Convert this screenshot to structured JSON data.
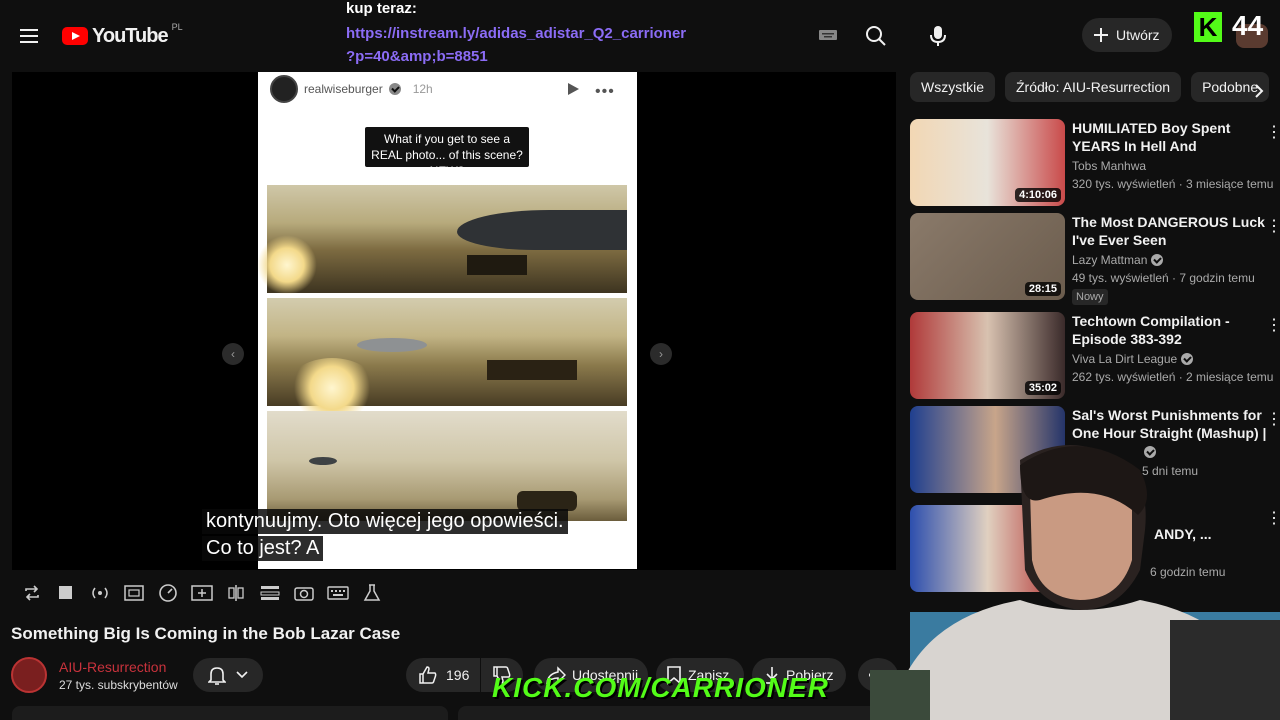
{
  "header": {
    "logo_text": "YouTube",
    "logo_country": "PL",
    "create_label": "Utwórz",
    "search_icon": "search-icon",
    "mic_icon": "mic-icon"
  },
  "stream_overlay": {
    "buy_label": "kup teraz:",
    "buy_link": "https://instream.ly/adidas_adistar_Q2_carrioner\n?p=40&amp;b=8851",
    "badge_letter": "K",
    "badge_count": "44",
    "kick_url": "KICK.COM/CARRIONER"
  },
  "player": {
    "post_user": "realwiseburger",
    "post_time": "12h",
    "post_question": "What if you get to see a REAL photo... of this scene? NEW?",
    "subtitle_line1": "kontynuujmy.  Oto więcej jego opowieści.",
    "subtitle_line2": "Co to jest?  A"
  },
  "video": {
    "title": "Something Big Is Coming in the Bob Lazar Case",
    "channel_name": "AIU-Resurrection",
    "channel_subs": "27 tys. subskrybentów",
    "likes": "196",
    "share_label": "Udostępnij",
    "save_label": "Zapisz",
    "download_label": "Pobierz"
  },
  "chips": [
    "Wszystkie",
    "Źródło: AIU-Resurrection",
    "Podobne"
  ],
  "recommendations": [
    {
      "title": "HUMILIATED Boy Spent YEARS In Hell And INSTANTLY Became...",
      "channel": "Tobs Manhwa",
      "verified": false,
      "meta": "320 tys. wyświetleń · 3 miesiące temu",
      "duration": "4:10:06",
      "badge": "",
      "thumb_color": "#c9b9a4"
    },
    {
      "title": "The Most DANGEROUS Luck I've Ever Seen",
      "channel": "Lazy Mattman",
      "verified": true,
      "meta": "49 tys. wyświetleń · 7 godzin temu",
      "duration": "28:15",
      "badge": "Nowy",
      "thumb_color": "#7a6a5c"
    },
    {
      "title": "Techtown Compilation - Episode 383-392",
      "channel": "Viva La Dirt League",
      "verified": true,
      "meta": "262 tys. wyświetleń · 2 miesiące temu",
      "duration": "35:02",
      "badge": "",
      "thumb_color": "#8b2a2a"
    },
    {
      "title": "Sal's Worst Punishments for One Hour Straight (Mashup) | ...",
      "channel": "",
      "verified": true,
      "meta": "5 dni temu",
      "duration": "",
      "badge": "",
      "thumb_color": "#2a4fa8"
    },
    {
      "title": "ANDY, ...",
      "channel": "",
      "verified": false,
      "meta": "6 godzin temu",
      "duration": "",
      "badge": "",
      "thumb_color": "#3a4a7a"
    }
  ]
}
